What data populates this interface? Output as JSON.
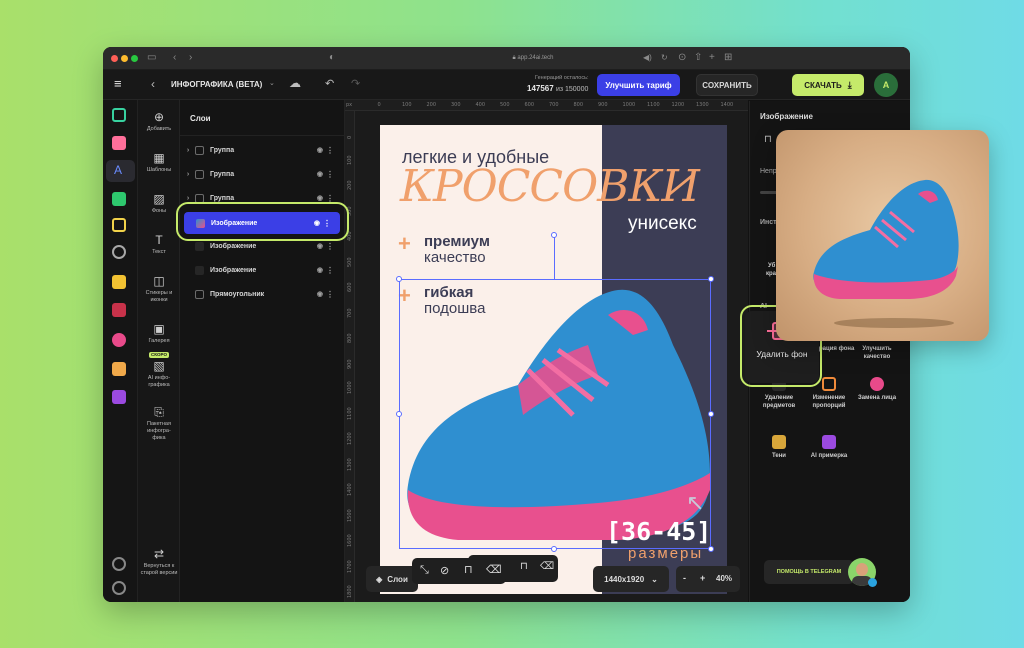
{
  "browser": {
    "url": "app.24ai.tech"
  },
  "header": {
    "title": "ИНФОГРАФИКА (BETA)",
    "generations_label": "Генераций осталось:",
    "generations_used": "147567",
    "generations_of": "из 150000",
    "upgrade_label": "Улучшить тариф",
    "save_label": "СОХРАНИТЬ",
    "download_label": "СКАЧАТЬ",
    "avatar_letter": "A"
  },
  "tools": [
    {
      "label": "Добавить"
    },
    {
      "label": "Шаблоны"
    },
    {
      "label": "Фоны"
    },
    {
      "label": "Текст"
    },
    {
      "label": "Стикеры и иконки"
    },
    {
      "label": "Галерея"
    },
    {
      "label": "AI инфо-графика",
      "badge": "СКОРО"
    },
    {
      "label": "Пакетная инфогра-фика"
    }
  ],
  "back_label": "Вернуться к старой версии",
  "layers": {
    "title": "Слои",
    "items": [
      {
        "label": "Группа"
      },
      {
        "label": "Группа"
      },
      {
        "label": "Группа"
      },
      {
        "label": "Изображение"
      },
      {
        "label": "Изображение"
      },
      {
        "label": "Изображение"
      },
      {
        "label": "Прямоугольник"
      }
    ]
  },
  "ruler": {
    "top": [
      "px",
      "0",
      "100",
      "200",
      "300",
      "400",
      "500",
      "600",
      "700",
      "800",
      "900",
      "1000",
      "1100",
      "1200",
      "1300",
      "1400"
    ],
    "left": [
      "0",
      "100",
      "200",
      "300",
      "400",
      "500",
      "600",
      "700",
      "800",
      "900",
      "1000",
      "1100",
      "1200",
      "1300",
      "1400",
      "1500",
      "1600",
      "1700",
      "1800"
    ]
  },
  "poster": {
    "line1": "легкие и удобные",
    "brand": "КРОССОВКИ",
    "unisex": "унисекс",
    "f1_bold": "премиум",
    "f1_light": "качество",
    "f2_bold": "гибкая",
    "f2_light": "подошва",
    "sizes": "[36-45]",
    "sizes_word": "размеры"
  },
  "bottom": {
    "layers_label": "Слои",
    "canvas_size": "1440x1920",
    "zoom_minus": "-",
    "zoom_plus": "+",
    "zoom_value": "40%"
  },
  "right_panel": {
    "title": "Изображение",
    "label_partial_1": "Непр",
    "label_partial_2": "Инст",
    "label_partial_3": "Уб",
    "label_partial_4": "кра",
    "label_partial_5": "AI",
    "tools": [
      {
        "label": "Удалить фон"
      },
      {
        "label": "Генерация фона"
      },
      {
        "label": "Улучшить качество"
      },
      {
        "label": "Удаление предметов"
      },
      {
        "label": "Изменение пропорций"
      },
      {
        "label": "Замена лица"
      },
      {
        "label": "Тени"
      },
      {
        "label": "AI примерка"
      }
    ],
    "telegram_help": "ПОМОЩЬ В TELEGRAM"
  },
  "colors": {
    "accent_blue": "#3b3fe6",
    "accent_green": "#c5ea6a",
    "poster_navy": "#3c3d55",
    "poster_orange": "#f0a06c",
    "shoe_blue": "#2f8fd0",
    "shoe_pink": "#e8508e"
  }
}
